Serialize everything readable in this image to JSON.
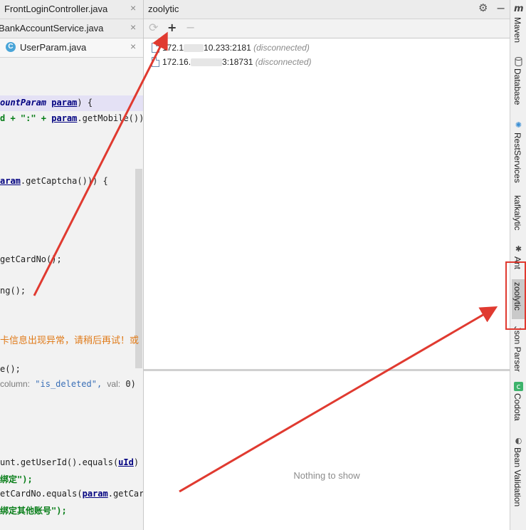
{
  "editor": {
    "tabs": [
      {
        "label": "FrontLoginController.java",
        "close": "×"
      },
      {
        "label": "BankAccountService.java",
        "close": "×"
      },
      {
        "label": "UserParam.java",
        "close": "×",
        "icon": "C"
      }
    ],
    "code": {
      "l1a": "ountParam",
      "l1b": "param",
      "l1c": ") {",
      "l2a": "d + \":\" + ",
      "l2b": "param",
      "l2c": ".getMobile());",
      "l3a": "aram",
      "l3b": ".getCaptcha())) {",
      "l4": "getCardNo();",
      "l5": "ng();",
      "l6": "卡信息出现异常，请稍后再试！或",
      "l7": "e();",
      "l8a": "column:",
      "l8b": "\"is_deleted\",",
      "l8c": "val:",
      "l8d": "0)",
      "l9a": "unt.getUserId().equals(",
      "l9b": "uId",
      "l9c": ")",
      "l10": "绑定\");",
      "l11a": "etCardNo.equals(",
      "l11b": "param",
      "l11c": ".getCard",
      "l12": "绑定其他账号\");"
    }
  },
  "panel": {
    "title": "zoolytic",
    "toolbar": {
      "refresh": "⟳",
      "add": "+",
      "remove": "−"
    },
    "nodes": [
      {
        "prefix": "172.1",
        "suffix": "10.233:2181",
        "status": "(disconnected)"
      },
      {
        "prefix": "172.16.",
        "suffix": "3:18731",
        "status": "(disconnected)"
      }
    ],
    "empty_text": "Nothing to show",
    "header_icons": {
      "settings": "⚙",
      "minimize": "−"
    }
  },
  "sidebar": {
    "logo": "m",
    "items": [
      {
        "label": "Maven",
        "icon": "maven-icon"
      },
      {
        "label": "Database",
        "icon": "database-icon"
      },
      {
        "label": "RestServices",
        "icon": "restservices-icon"
      },
      {
        "label": "kafkalytic",
        "icon": ""
      },
      {
        "label": "Ant",
        "icon": "ant-icon"
      },
      {
        "label": "zoolytic",
        "icon": ""
      },
      {
        "label": "Json Parser",
        "icon": ""
      },
      {
        "label": "Codota",
        "icon": "codota-icon"
      },
      {
        "label": "Bean Validation",
        "icon": "bean-validation-icon"
      }
    ]
  },
  "colors": {
    "annotation": "#e03a30",
    "highlight_line": "#e4e1f5"
  }
}
